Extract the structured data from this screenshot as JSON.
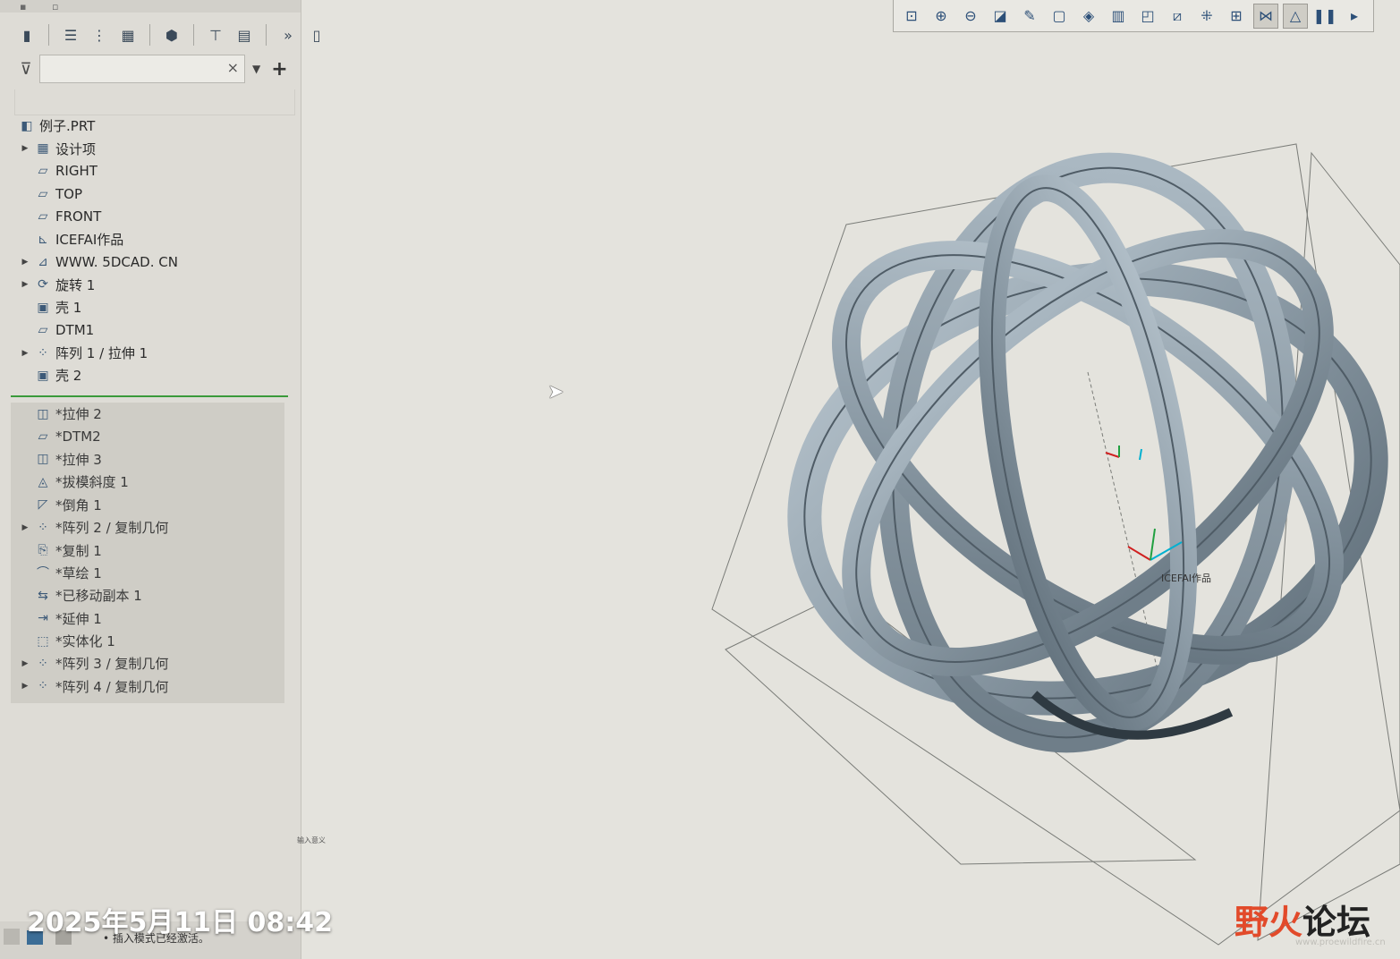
{
  "model_tree": {
    "toolbar_icons": [
      "list-icon",
      "columns-icon",
      "table-icon",
      "layers-icon",
      "filter-tree-icon",
      "settings-icon",
      "more-icon",
      "notes-icon"
    ],
    "more_label": "»",
    "search": {
      "value": "",
      "placeholder": "",
      "clear_label": "×"
    },
    "add_label": "+",
    "root": "例子.PRT",
    "items": [
      {
        "label": "设计项",
        "expandable": true,
        "icon": "layer-grid-icon"
      },
      {
        "label": "RIGHT",
        "expandable": false,
        "icon": "datum-plane-icon"
      },
      {
        "label": "TOP",
        "expandable": false,
        "icon": "datum-plane-icon"
      },
      {
        "label": "FRONT",
        "expandable": false,
        "icon": "datum-plane-icon"
      },
      {
        "label": "ICEFAI作品",
        "expandable": false,
        "icon": "coordinate-system-icon"
      },
      {
        "label": "WWW. 5DCAD. CN",
        "expandable": true,
        "icon": "annotation-icon"
      },
      {
        "label": "旋转 1",
        "expandable": true,
        "icon": "revolve-icon"
      },
      {
        "label": "壳 1",
        "expandable": false,
        "icon": "shell-icon"
      },
      {
        "label": "DTM1",
        "expandable": false,
        "icon": "datum-plane-icon"
      },
      {
        "label": "阵列 1 / 拉伸 1",
        "expandable": true,
        "icon": "pattern-icon"
      },
      {
        "label": "壳 2",
        "expandable": false,
        "icon": "shell-icon"
      }
    ],
    "after_insert": [
      {
        "label": "*拉伸 2",
        "expandable": false,
        "icon": "extrude-icon"
      },
      {
        "label": "*DTM2",
        "expandable": false,
        "icon": "datum-plane-icon"
      },
      {
        "label": "*拉伸 3",
        "expandable": false,
        "icon": "extrude-icon"
      },
      {
        "label": "*拔模斜度 1",
        "expandable": false,
        "icon": "draft-icon"
      },
      {
        "label": "*倒角 1",
        "expandable": false,
        "icon": "chamfer-icon"
      },
      {
        "label": "*阵列 2 / 复制几何",
        "expandable": true,
        "icon": "pattern-icon"
      },
      {
        "label": "*复制 1",
        "expandable": false,
        "icon": "copy-icon"
      },
      {
        "label": "*草绘 1",
        "expandable": false,
        "icon": "sketch-icon"
      },
      {
        "label": "*已移动副本 1",
        "expandable": false,
        "icon": "moved-copy-icon"
      },
      {
        "label": "*延伸 1",
        "expandable": false,
        "icon": "extend-icon"
      },
      {
        "label": "*实体化 1",
        "expandable": false,
        "icon": "solidify-icon"
      },
      {
        "label": "*阵列 3 / 复制几何",
        "expandable": true,
        "icon": "pattern-icon"
      },
      {
        "label": "*阵列 4 / 复制几何",
        "expandable": true,
        "icon": "pattern-icon"
      }
    ]
  },
  "view_toolbar": {
    "icons": [
      "refit-icon",
      "zoom-in-icon",
      "zoom-out-icon",
      "repaint-icon",
      "reorient-icon",
      "saved-views-icon",
      "display-style-icon",
      "view-manager-icon",
      "perspective-icon",
      "datum-display-icon",
      "annotation-display-icon",
      "spin-center-icon",
      "csys-display-icon",
      "hidden-line-icon",
      "pause-icon",
      "more-icon"
    ],
    "active": [
      12,
      13
    ]
  },
  "viewport": {
    "model_label": "ICEFAI作品",
    "small_text": "输入意义"
  },
  "status_bar": {
    "text": "• 插入模式已经激活。"
  },
  "overlay": {
    "timestamp": "2025年5月11日 08:42",
    "watermark_a": "野火",
    "watermark_b": "论坛",
    "watermark_url": "www.proewildfire.cn"
  },
  "colors": {
    "background": "#e4e3dd",
    "panel": "#dedcd6",
    "insert_line": "#3a9a3a",
    "model": "#8fa0ac",
    "icon_blue": "#3d5a78"
  }
}
